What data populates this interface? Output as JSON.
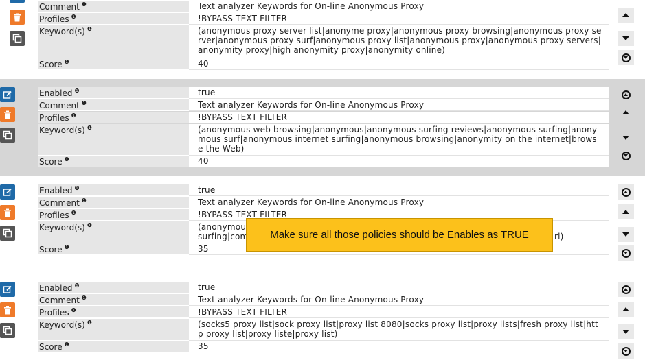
{
  "info_glyph": "❶",
  "labels": {
    "enabled": "Enabled",
    "comment": "Comment",
    "profiles": "Profiles",
    "keywords": "Keyword(s)",
    "score": "Score"
  },
  "policies": [
    {
      "comment": "Text analyzer Keywords for On-line Anonymous Proxy",
      "profiles": "!BYPASS TEXT FILTER",
      "keywords": "(anonymous proxy server list|anonyme proxy|anonymous proxy browsing|anonymous proxy server|anonymous proxy surf|anonymous proxy list|anonymous proxy|anonymous proxy servers|anonymity proxy|high anonymity proxy|anonymity online)",
      "score": "40"
    },
    {
      "enabled": "true",
      "comment": "Text analyzer Keywords for On-line Anonymous Proxy",
      "profiles": "!BYPASS TEXT FILTER",
      "keywords": "(anonymous web browsing|anonymous|anonymous surfing reviews|anonymous surfing|anonymous surf|anonymous internet surfing|anonymous browsing|anonymity on the internet|browse the Web)",
      "score": "40"
    },
    {
      "enabled": "true",
      "comment": "Text analyzer Keywords for On-line Anonymous Proxy",
      "profiles": "!BYPASS TEXT FILTER",
      "keywords_line1": "(anonymou",
      "keywords_line2": "surfing|com",
      "keywords_tail": "rl)",
      "score": "35"
    },
    {
      "enabled": "true",
      "comment": "Text analyzer Keywords for On-line Anonymous Proxy",
      "profiles": "!BYPASS TEXT FILTER",
      "keywords": "(socks5 proxy list|sock proxy list|proxy list 8080|socks proxy list|proxy lists|fresh proxy list|http proxy list|proxy liste|proxy list)",
      "score": "35"
    }
  ],
  "callout": "Make sure all those policies should be Enables as TRUE",
  "colors": {
    "edit": "#1f6aa8",
    "delete": "#ef7a2a",
    "copy": "#555555",
    "callout": "#fcc11b",
    "selected_row": "#d6d6d6"
  }
}
